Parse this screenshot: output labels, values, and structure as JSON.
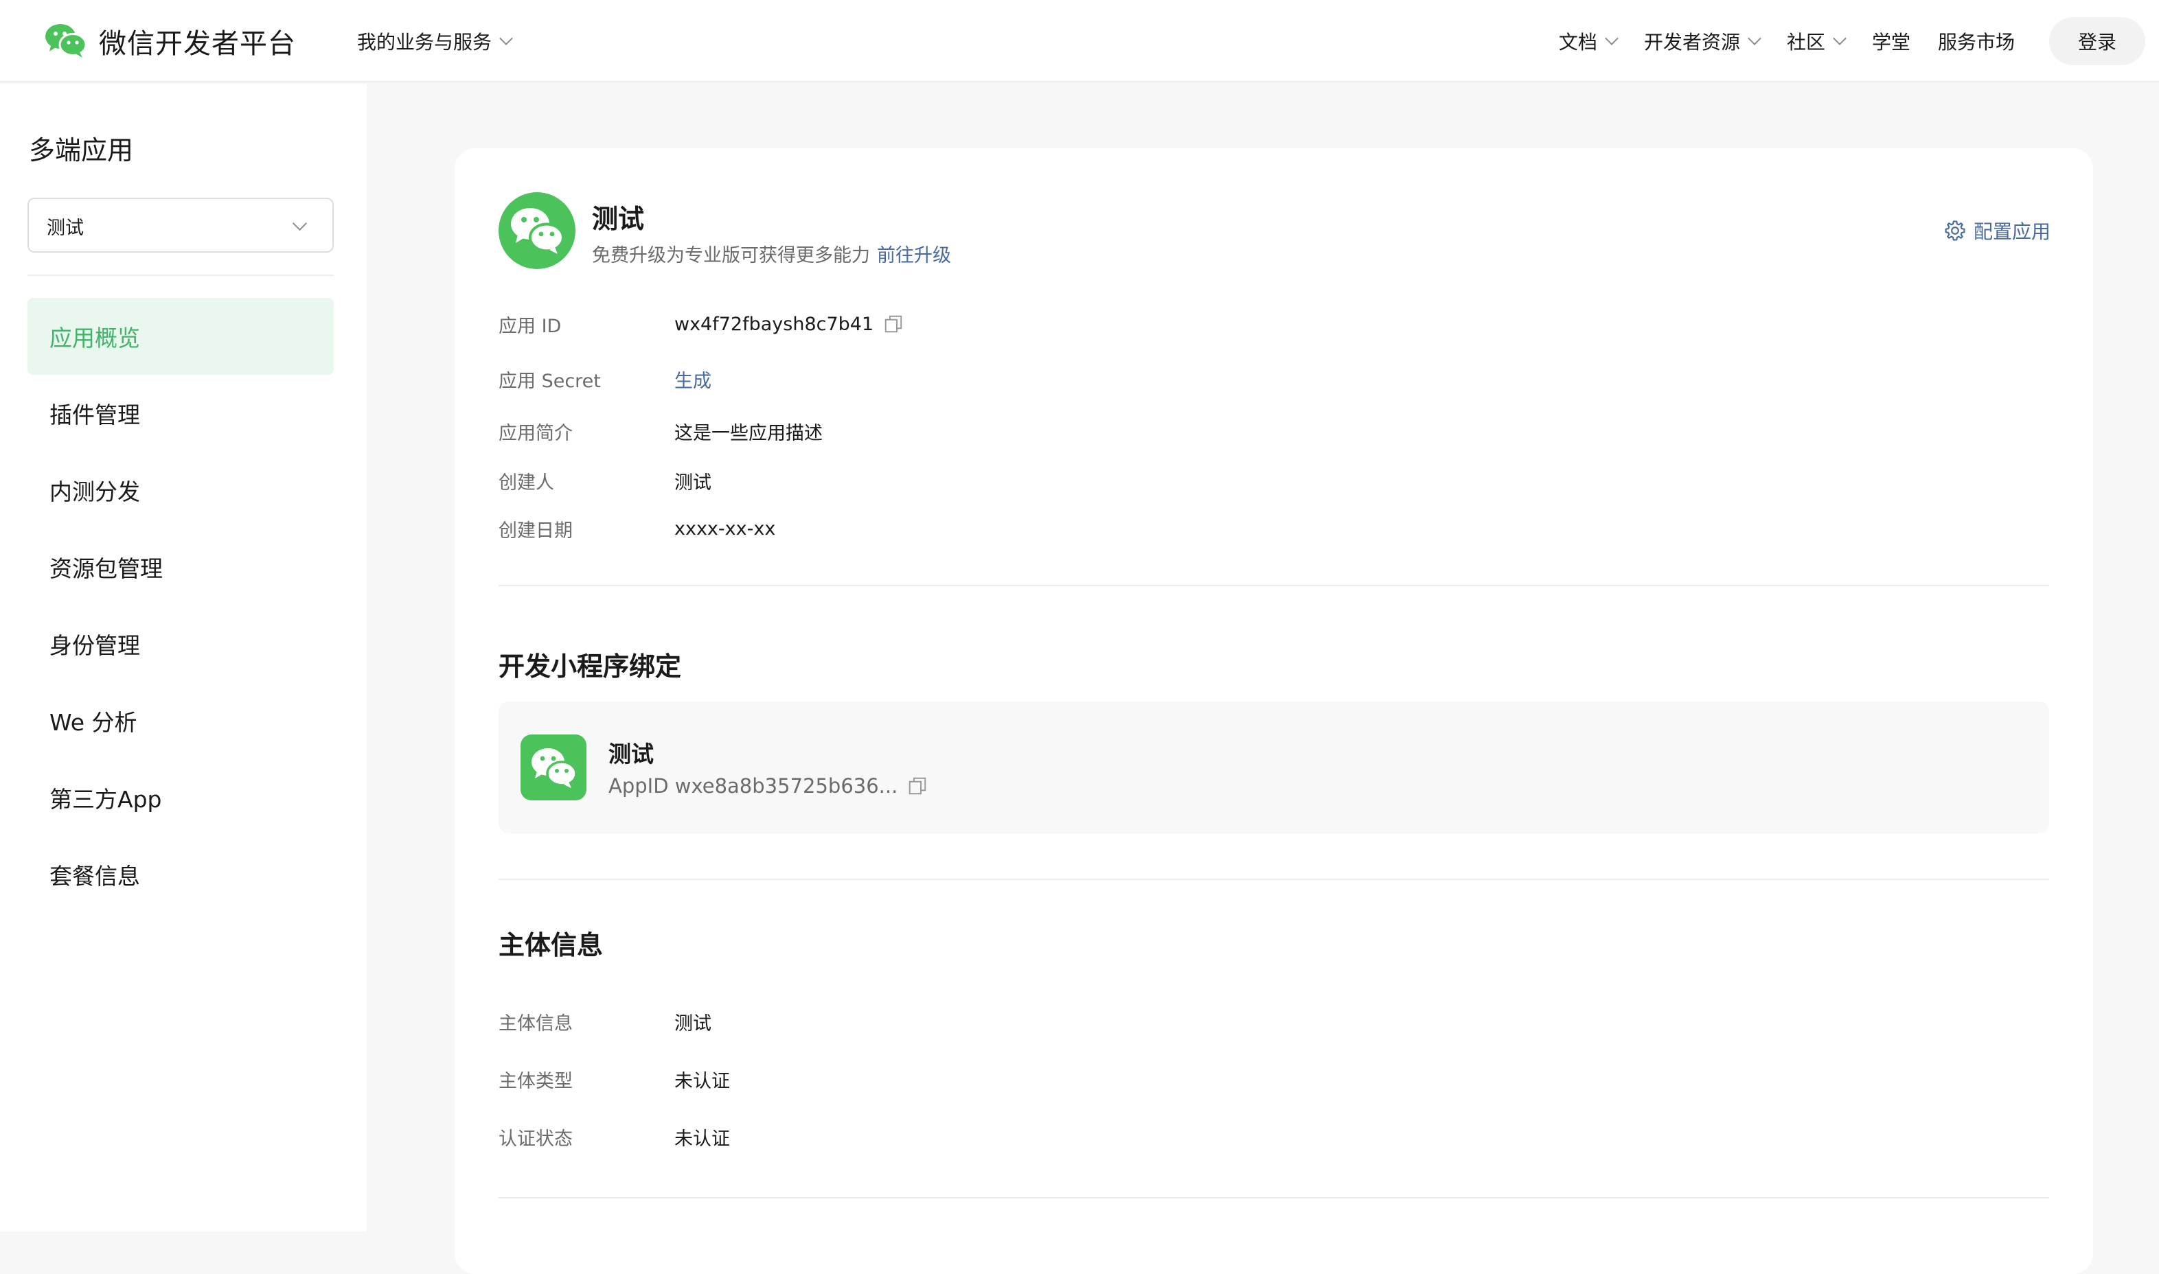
{
  "brand": {
    "name": "微信开发者平台",
    "icon": "wechat-logo-icon",
    "color": "#4bc25a"
  },
  "topnav": {
    "business_label": "我的业务与服务",
    "items": [
      {
        "label": "文档",
        "has_dropdown": true
      },
      {
        "label": "开发者资源",
        "has_dropdown": true
      },
      {
        "label": "社区",
        "has_dropdown": true
      },
      {
        "label": "学堂",
        "has_dropdown": false
      },
      {
        "label": "服务市场",
        "has_dropdown": false
      }
    ],
    "login_label": "登录"
  },
  "sidebar": {
    "title": "多端应用",
    "app_select_value": "测试",
    "items": [
      {
        "label": "应用概览",
        "active": true
      },
      {
        "label": "插件管理",
        "active": false
      },
      {
        "label": "内测分发",
        "active": false
      },
      {
        "label": "资源包管理",
        "active": false
      },
      {
        "label": "身份管理",
        "active": false
      },
      {
        "label": "We 分析",
        "active": false
      },
      {
        "label": "第三方App",
        "active": false
      },
      {
        "label": "套餐信息",
        "active": false
      }
    ],
    "active_color": "#41b36a"
  },
  "app": {
    "name": "测试",
    "upgrade_text": "免费升级为专业版可获得更多能力",
    "upgrade_link": "前往升级",
    "config_label": "配置应用",
    "fields": [
      {
        "label": "应用 ID",
        "value": "wx4f72fbaysh8c7b41"
      },
      {
        "label": "应用 Secret",
        "value": "生成"
      },
      {
        "label": "应用简介",
        "value": "这是一些应用描述"
      },
      {
        "label": "创建人",
        "value": "测试"
      },
      {
        "label": "创建日期",
        "value": "xxxx-xx-xx"
      }
    ]
  },
  "miniprogram": {
    "section_title": "开发小程序绑定",
    "name": "测试",
    "appid_text": "AppID wxe8a8b35725b636..."
  },
  "entity": {
    "section_title": "主体信息",
    "fields": [
      {
        "label": "主体信息",
        "value": "测试"
      },
      {
        "label": "主体类型",
        "value": "未认证"
      },
      {
        "label": "认证状态",
        "value": "未认证"
      }
    ]
  },
  "link_color": "#486aa3"
}
